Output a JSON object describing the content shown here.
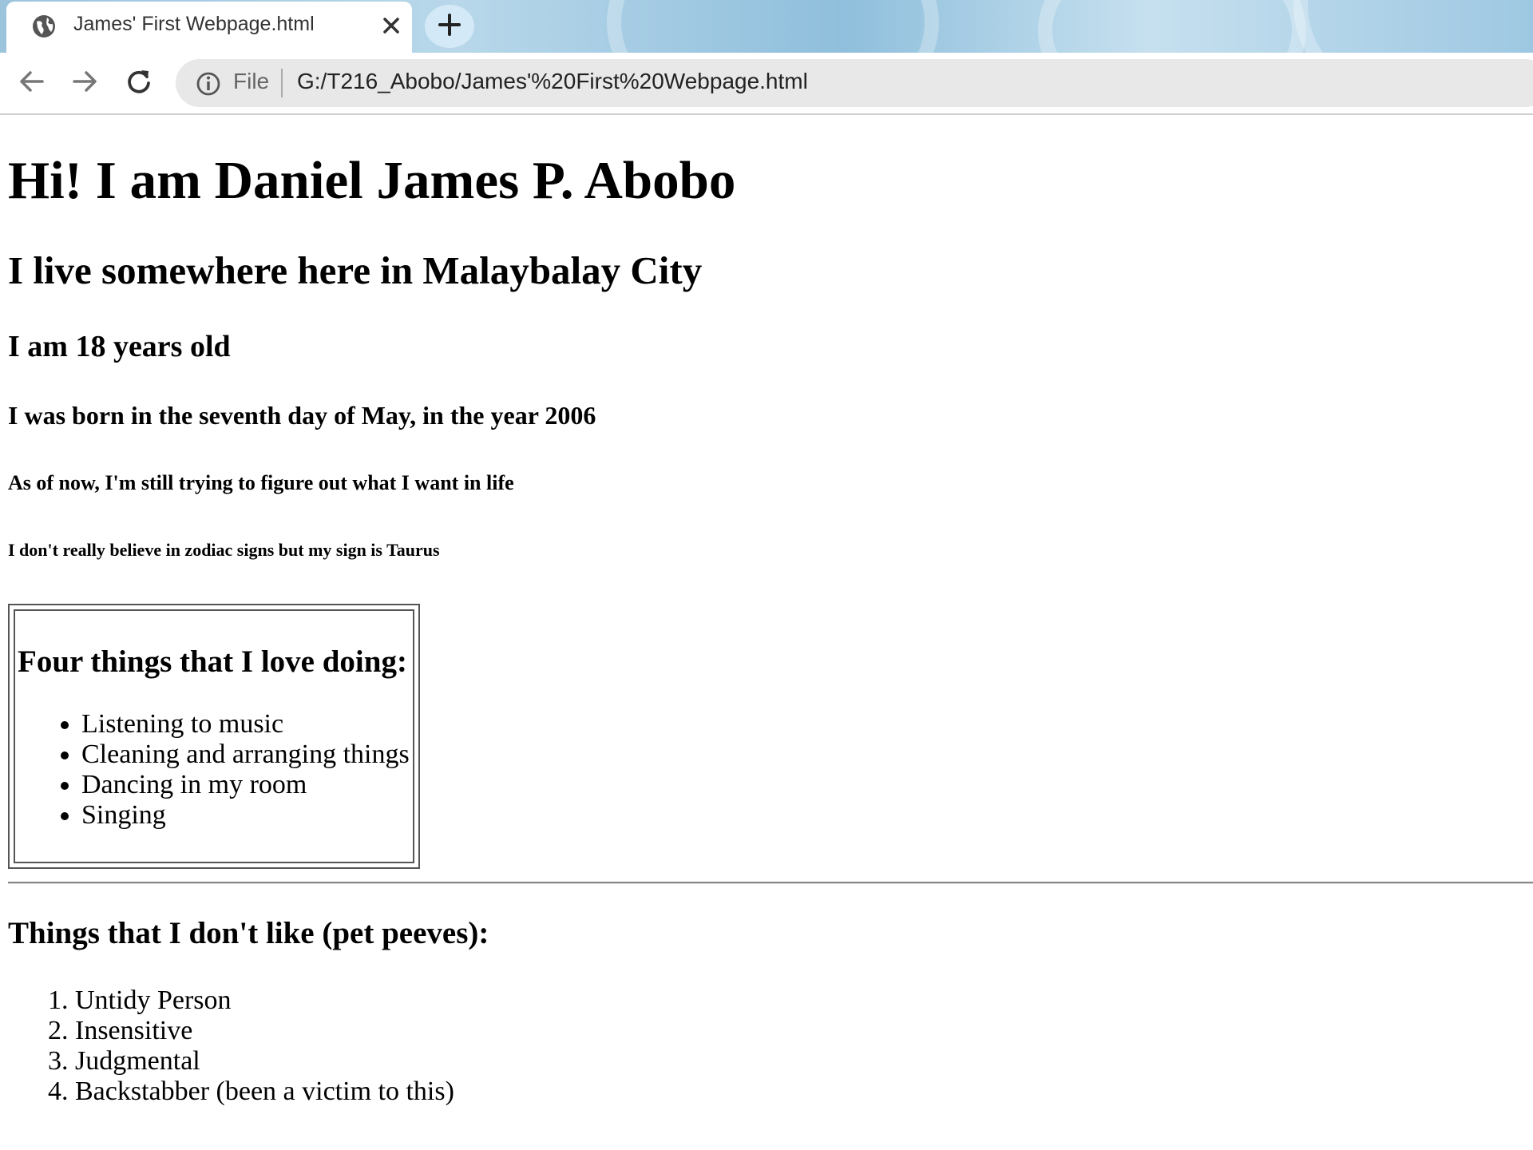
{
  "browser": {
    "tab_title": "James' First Webpage.html",
    "close_icon": "close-icon",
    "new_tab_icon": "plus-icon",
    "address": {
      "scheme_label": "File",
      "url": "G:/T216_Abobo/James'%20First%20Webpage.html"
    }
  },
  "page": {
    "h1": "Hi! I am Daniel James P. Abobo",
    "h2": "I live somewhere here in Malaybalay City",
    "h3": "I am 18 years old",
    "h4": "I was born in the seventh day of May, in the year 2006",
    "h5": "As of now, I'm still trying to figure out what I want in life",
    "h6": "I don't really believe in zodiac signs but my sign is Taurus",
    "loves": {
      "heading": "Four things that I love doing:",
      "items": [
        "Listening to music",
        "Cleaning and arranging things",
        "Dancing in my room",
        "Singing"
      ]
    },
    "peeves": {
      "heading": "Things that I don't like (pet peeves):",
      "items": [
        "Untidy Person",
        "Insensitive",
        "Judgmental",
        "Backstabber (been a victim to this)"
      ]
    }
  }
}
